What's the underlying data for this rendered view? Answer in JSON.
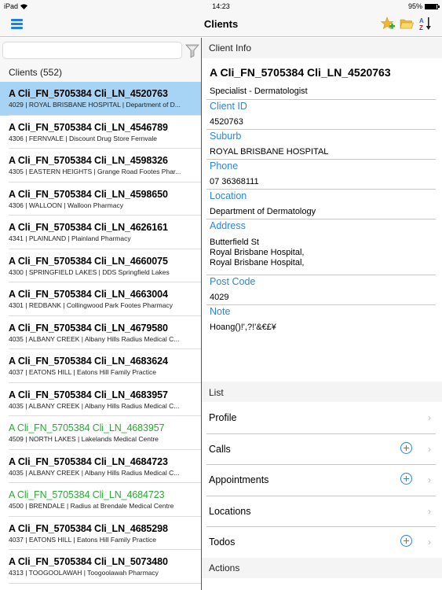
{
  "status_bar": {
    "carrier": "iPad",
    "time": "14:23",
    "battery_percent": "95%",
    "battery_level": 0.95
  },
  "nav": {
    "title": "Clients",
    "menu_icon": "hamburger-menu-icon",
    "actions": [
      {
        "name": "add-favorite",
        "icon": "star-plus-icon"
      },
      {
        "name": "open-folder",
        "icon": "folder-icon"
      },
      {
        "name": "sort-az",
        "icon": "sort-az-icon"
      }
    ]
  },
  "left": {
    "search": {
      "value": "",
      "placeholder": ""
    },
    "filter_icon": "funnel-filter-icon",
    "clients_header": "Clients (552)",
    "clients": [
      {
        "name": "A Cli_FN_5705384  Cli_LN_4520763",
        "sub": "4029 | ROYAL BRISBANE HOSPITAL | Department of D...",
        "selected": true,
        "green": false
      },
      {
        "name": "A Cli_FN_5705384  Cli_LN_4546789",
        "sub": "4306 | FERNVALE | Discount Drug Store Fernvale",
        "selected": false,
        "green": false
      },
      {
        "name": "A Cli_FN_5705384  Cli_LN_4598326",
        "sub": "4305 | EASTERN HEIGHTS | Grange Road Footes Phar...",
        "selected": false,
        "green": false
      },
      {
        "name": "A Cli_FN_5705384  Cli_LN_4598650",
        "sub": "4306 | WALLOON | Walloon Pharmacy",
        "selected": false,
        "green": false
      },
      {
        "name": "A Cli_FN_5705384  Cli_LN_4626161",
        "sub": "4341 | PLAINLAND | Plainland Pharmacy",
        "selected": false,
        "green": false
      },
      {
        "name": "A Cli_FN_5705384  Cli_LN_4660075",
        "sub": "4300 | SPRINGFIELD LAKES | DDS Springfield Lakes",
        "selected": false,
        "green": false
      },
      {
        "name": "A Cli_FN_5705384  Cli_LN_4663004",
        "sub": "4301 | REDBANK | Collingwood Park Footes Pharmacy",
        "selected": false,
        "green": false
      },
      {
        "name": "A Cli_FN_5705384  Cli_LN_4679580",
        "sub": "4035 | ALBANY CREEK | Albany Hills Radius Medical C...",
        "selected": false,
        "green": false
      },
      {
        "name": "A Cli_FN_5705384  Cli_LN_4683624",
        "sub": "4037 | EATONS HILL | Eatons Hill Family Practice",
        "selected": false,
        "green": false
      },
      {
        "name": "A Cli_FN_5705384  Cli_LN_4683957",
        "sub": "4035 | ALBANY CREEK | Albany Hills Radius Medical C...",
        "selected": false,
        "green": false
      },
      {
        "name": "A Cli_FN_5705384  Cli_LN_4683957",
        "sub": "4509 | NORTH LAKES | Lakelands Medical Centre",
        "selected": false,
        "green": true
      },
      {
        "name": "A Cli_FN_5705384  Cli_LN_4684723",
        "sub": "4035 | ALBANY CREEK | Albany Hills Radius Medical C...",
        "selected": false,
        "green": false
      },
      {
        "name": "A Cli_FN_5705384  Cli_LN_4684723",
        "sub": "4500 | BRENDALE | Radius at Brendale Medical Centre",
        "selected": false,
        "green": true
      },
      {
        "name": "A Cli_FN_5705384  Cli_LN_4685298",
        "sub": "4037 | EATONS HILL | Eatons Hill Family Practice",
        "selected": false,
        "green": false
      },
      {
        "name": "A Cli_FN_5705384  Cli_LN_5073480",
        "sub": "4313 | TOOGOOLAWAH | Toogoolawah Pharmacy",
        "selected": false,
        "green": false
      }
    ]
  },
  "right": {
    "section_title": "Client Info",
    "client_name": "A Cli_FN_5705384  Cli_LN_4520763",
    "client_type": "Specialist - Dermatologist",
    "fields": {
      "client_id": {
        "label": "Client ID",
        "value": "4520763"
      },
      "suburb": {
        "label": "Suburb",
        "value": "ROYAL BRISBANE HOSPITAL"
      },
      "phone": {
        "label": "Phone",
        "value": "07 36368111"
      },
      "location": {
        "label": "Location",
        "value": "Department of Dermatology"
      },
      "address": {
        "label": "Address",
        "lines": [
          "Butterfield St",
          "Royal Brisbane Hospital,",
          "Royal Brisbane Hospital,"
        ]
      },
      "post_code": {
        "label": "Post Code",
        "value": "4029"
      },
      "note": {
        "label": "Note",
        "value": "Hoang()!',?!'&€£¥"
      }
    },
    "list_header": "List",
    "list_items": [
      {
        "label": "Profile",
        "has_add": false
      },
      {
        "label": "Calls",
        "has_add": true
      },
      {
        "label": "Appointments",
        "has_add": true
      },
      {
        "label": "Locations",
        "has_add": false
      },
      {
        "label": "Todos",
        "has_add": true
      }
    ],
    "chevron_glyph": "›",
    "actions_header": "Actions"
  },
  "colors": {
    "accent_blue": "#2f85d8",
    "selected_row": "#a7d4f5",
    "green_text": "#2ea63a"
  }
}
